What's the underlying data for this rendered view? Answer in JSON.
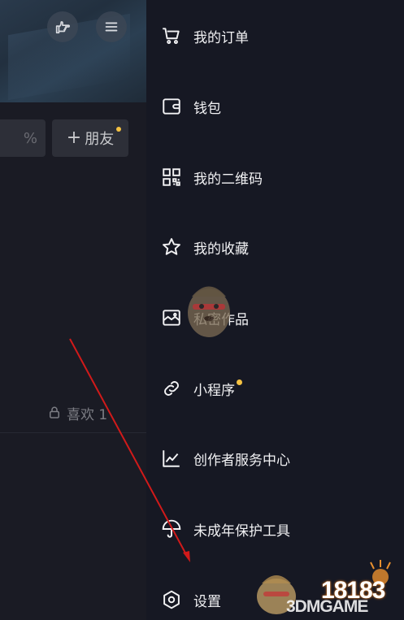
{
  "profile_panel": {
    "edit_button_glyph": "%",
    "add_friend_label": "朋友",
    "likes_tab_label": "喜欢 1"
  },
  "drawer": {
    "items": [
      {
        "label": "我的订单",
        "icon": "cart-icon"
      },
      {
        "label": "钱包",
        "icon": "wallet-icon"
      },
      {
        "label": "我的二维码",
        "icon": "qr-code-icon"
      },
      {
        "label": "我的收藏",
        "icon": "star-icon"
      },
      {
        "label": "私密作品",
        "icon": "private-works-icon"
      },
      {
        "label": "小程序",
        "icon": "mini-program-link-icon"
      },
      {
        "label": "创作者服务中心",
        "icon": "creator-chart-icon"
      },
      {
        "label": "未成年保护工具",
        "icon": "umbrella-icon"
      },
      {
        "label": "设置",
        "icon": "settings-hexagon-icon"
      }
    ]
  },
  "watermark": {
    "line1": "18183",
    "line2": "3DMGAME"
  },
  "colors": {
    "background": "#161823",
    "notification_dot": "#f5c242",
    "annotation_arrow": "#d11a1a"
  }
}
